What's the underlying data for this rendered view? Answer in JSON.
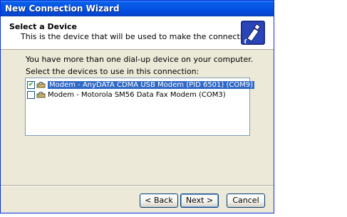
{
  "window": {
    "title": "New Connection Wizard"
  },
  "header": {
    "title": "Select a Device",
    "subtitle": "This is the device that will be used to make the connection.",
    "icon": "phone-plug-icon"
  },
  "body": {
    "intro": "You have more than one dial-up device on your computer.",
    "select_label": "Select the devices to use in this connection:",
    "devices": [
      {
        "label": "Modem - AnyDATA CDMA USB Modem (PID 6501) (COM9)",
        "checked": true,
        "selected": true,
        "icon": "modem-icon"
      },
      {
        "label": "Modem - Motorola SM56 Data Fax Modem (COM3)",
        "checked": false,
        "selected": false,
        "icon": "modem-icon"
      }
    ]
  },
  "buttons": {
    "back": "< Back",
    "next": "Next >",
    "cancel": "Cancel"
  },
  "colors": {
    "titlebar": "#0553e4",
    "selection": "#316ac5",
    "face": "#ece9d8"
  }
}
